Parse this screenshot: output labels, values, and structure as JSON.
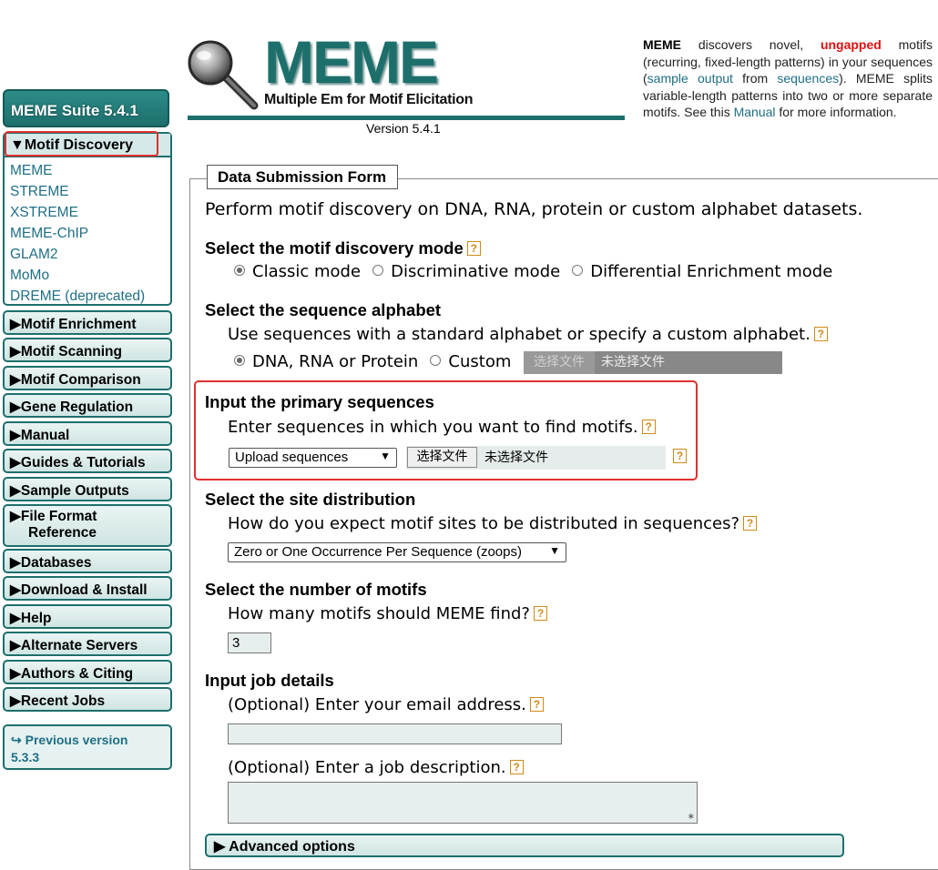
{
  "sidebar": {
    "suite_title": "MEME Suite 5.4.1",
    "open_group": {
      "label": "▼Motif Discovery",
      "links": [
        "MEME",
        "STREME",
        "XSTREME",
        "MEME-ChIP",
        "GLAM2",
        "MoMo",
        "DREME (deprecated)"
      ]
    },
    "groups": [
      "▶Motif Enrichment",
      "▶Motif Scanning",
      "▶Motif Comparison",
      "▶Gene Regulation",
      "▶Manual",
      "▶Guides & Tutorials",
      "▶Sample Outputs",
      "▶Databases",
      "▶Download & Install",
      "▶Help",
      "▶Alternate Servers",
      "▶Authors & Citing",
      "▶Recent Jobs"
    ],
    "file_format": {
      "line1": "▶File Format",
      "line2": "Reference"
    },
    "prev_version": {
      "line1": "↪ Previous version",
      "line2": "5.3.3"
    }
  },
  "header": {
    "logo_title": "MEME",
    "logo_subtitle": "Multiple Em for Motif Elicitation",
    "version": "Version 5.4.1"
  },
  "intro": {
    "brand": "MEME",
    "t1": " discovers novel, ",
    "ungapped": "ungapped",
    "t2": " motifs (recurring, fixed-length patterns) in your sequences (",
    "sample_output": "sample output",
    "t3": " from ",
    "sequences": "sequences",
    "t4": "). MEME splits variable-length patterns into two or more separate motifs. See this ",
    "manual": "Manual",
    "t5": " for more information."
  },
  "form": {
    "legend": "Data Submission Form",
    "lead": "Perform motif discovery on DNA, RNA, protein or custom alphabet datasets.",
    "help_glyph": "?",
    "mode": {
      "heading": "Select the motif discovery mode",
      "options": [
        "Classic mode",
        "Discriminative mode",
        "Differential Enrichment mode"
      ],
      "selected": "Classic mode"
    },
    "alphabet": {
      "heading": "Select the sequence alphabet",
      "description": "Use sequences with a standard alphabet or specify a custom alphabet.",
      "options": [
        "DNA, RNA or Protein",
        "Custom"
      ],
      "file_button": "选择文件",
      "file_status": "未选择文件"
    },
    "primary": {
      "heading": "Input the primary sequences",
      "description": "Enter sequences in which you want to find motifs.",
      "select_value": "Upload sequences",
      "file_button": "选择文件",
      "file_status": "未选择文件"
    },
    "site": {
      "heading": "Select the site distribution",
      "description": "How do you expect motif sites to be distributed in sequences?",
      "select_value": "Zero or One Occurrence Per Sequence (zoops)"
    },
    "nmotifs": {
      "heading": "Select the number of motifs",
      "description": "How many motifs should MEME find?",
      "value": "3"
    },
    "job": {
      "heading": "Input job details",
      "email_label": "(Optional) Enter your email address.",
      "email_value": "",
      "desc_label": "(Optional) Enter a job description.",
      "desc_value": ""
    },
    "advanced_label": "▶ Advanced options"
  }
}
